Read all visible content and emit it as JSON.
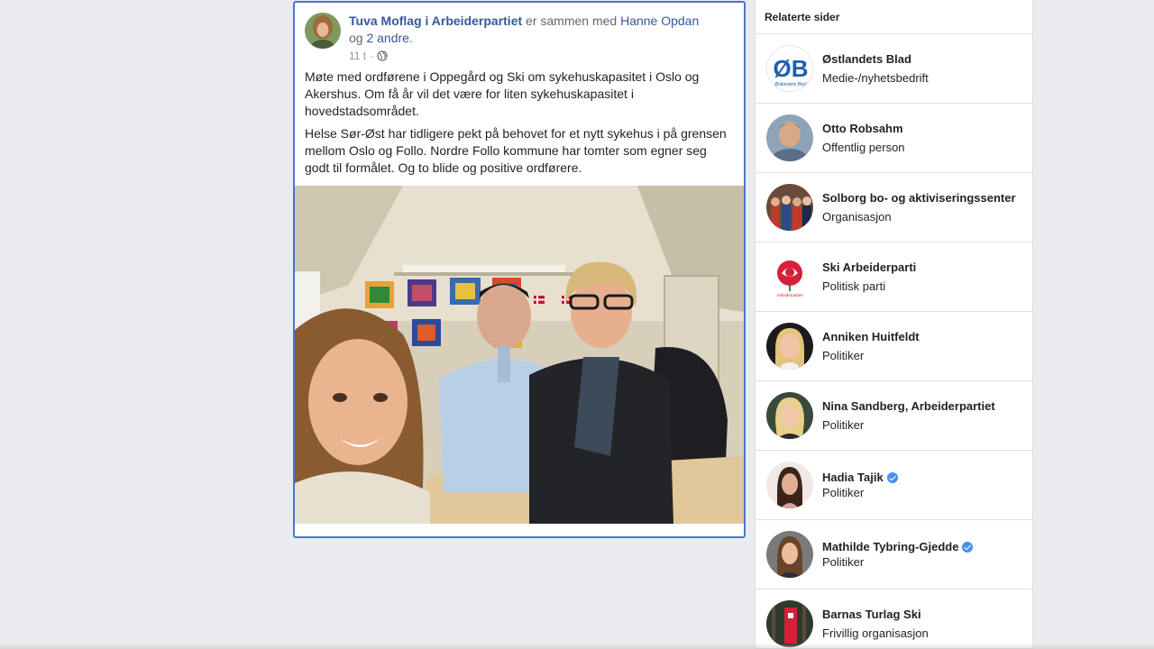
{
  "post": {
    "author": "Tuva Moflag i Arbeiderpartiet",
    "with_text": " er sammen med ",
    "tagged": "Hanne Opdan",
    "and_text": "og ",
    "others": "2 andre",
    "period": ".",
    "time": "11 t",
    "separator": "·",
    "paragraphs": [
      "Møte med ordførene i Oppegård og Ski om sykehuskapasitet i Oslo og Akershus. Om få år vil det være for liten sykehuskapasitet i hovedstadsområdet.",
      "Helse Sør-Øst har tidligere pekt på behovet for et nytt sykehus i på grensen mellom Oslo og Follo. Nordre Follo kommune har tomter som egner seg godt til formålet. Og to blide og positive ordførere."
    ]
  },
  "sidebar": {
    "title": "Relaterte sider",
    "items": [
      {
        "name": "Østlandets Blad",
        "category": "Medie-/nyhetsbedrift",
        "verified": false
      },
      {
        "name": "Otto Robsahm",
        "category": "Offentlig person",
        "verified": false
      },
      {
        "name": "Solborg bo- og aktiviseringssenter",
        "category": "Organisasjon",
        "verified": false
      },
      {
        "name": "Ski Arbeiderparti",
        "category": "Politisk parti",
        "verified": false
      },
      {
        "name": "Anniken Huitfeldt",
        "category": "Politiker",
        "verified": false
      },
      {
        "name": "Nina Sandberg, Arbeiderpartiet",
        "category": "Politiker",
        "verified": false
      },
      {
        "name": "Hadia Tajik",
        "category": "Politiker",
        "verified": true
      },
      {
        "name": "Mathilde Tybring-Gjedde",
        "category": "Politiker",
        "verified": true
      },
      {
        "name": "Barnas Turlag Ski",
        "category": "Frivillig organisasjon",
        "verified": false
      }
    ],
    "logo_text": "ØB",
    "logo_small": "Østlandets Blad",
    "ap_small": "Arbeiderpartiet"
  },
  "colors": {
    "link": "#385898",
    "focus_border": "#4a76c8",
    "background": "#e9ebee",
    "ap_red": "#d61f3a",
    "ob_blue": "#1f5fb0"
  }
}
